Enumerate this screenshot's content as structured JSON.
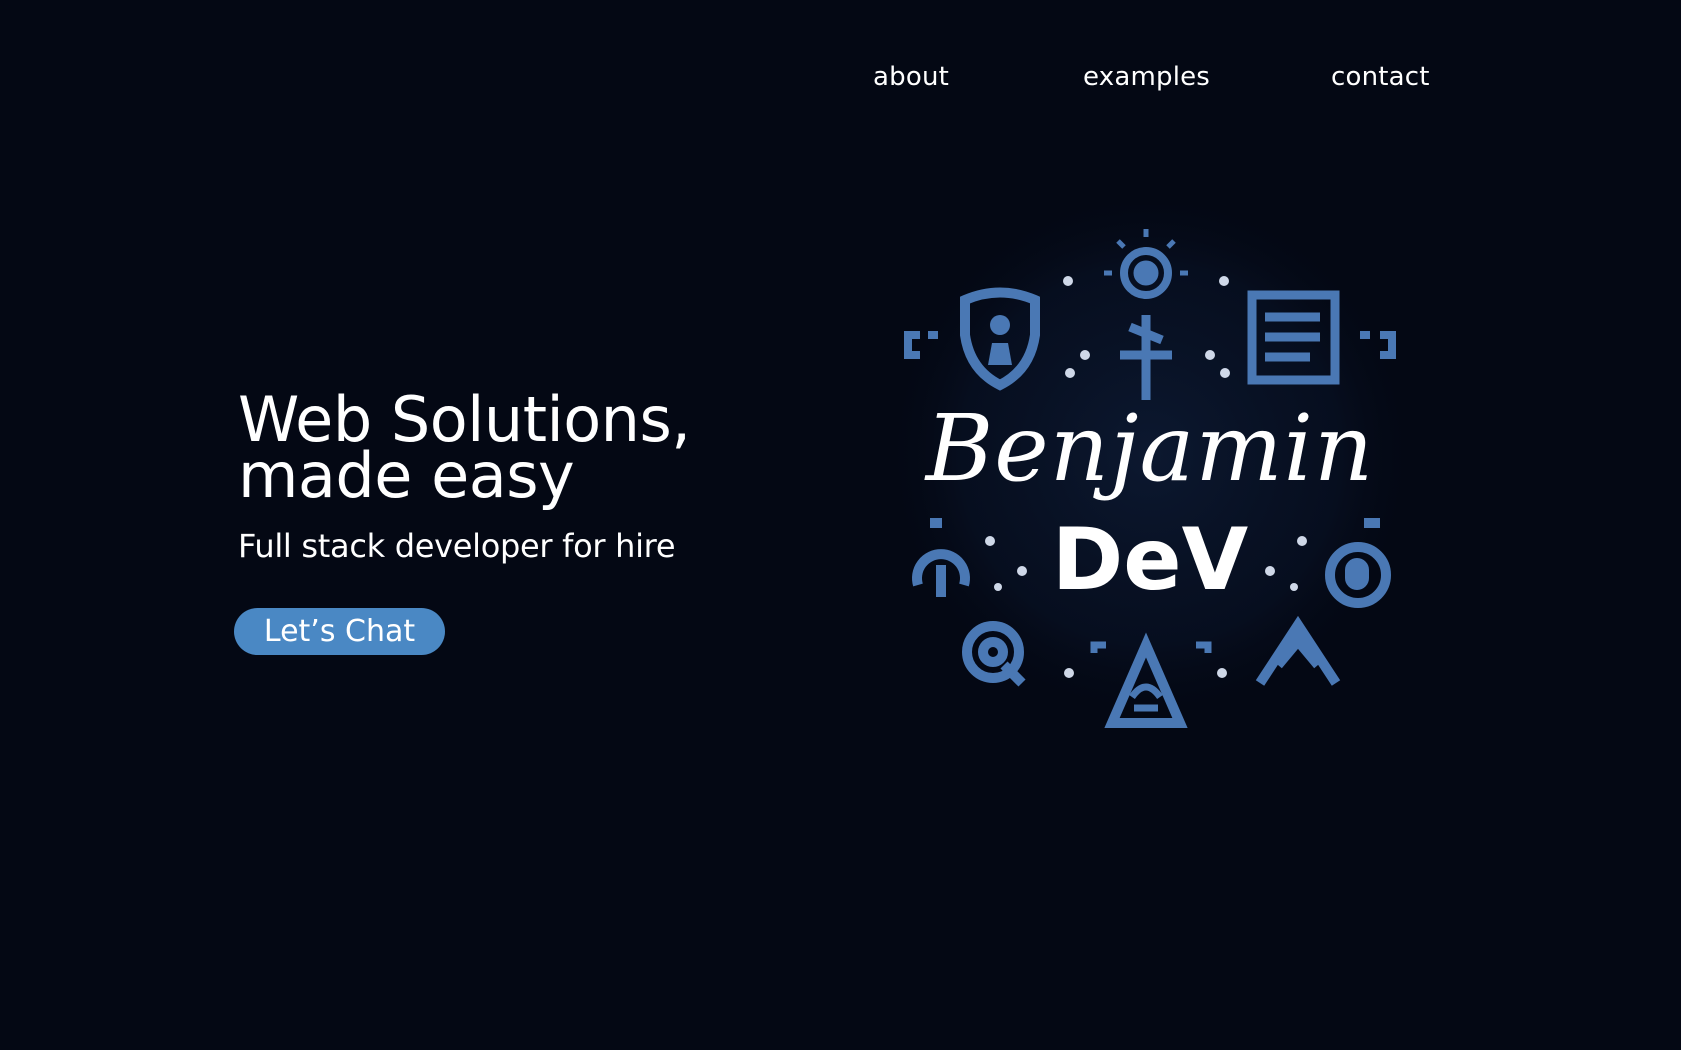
{
  "nav": {
    "about": "about",
    "examples": "examples",
    "contact": "contact"
  },
  "hero": {
    "title_line1": "Web Solutions,",
    "title_line2": "made easy",
    "subtitle": "Full stack developer for hire",
    "cta_label": "Let’s Chat"
  },
  "logo": {
    "line1": "Benjamin",
    "line2": "DeV"
  },
  "colors": {
    "background": "#040814",
    "accent": "#4a88c4",
    "icon": "#4a78b4"
  }
}
